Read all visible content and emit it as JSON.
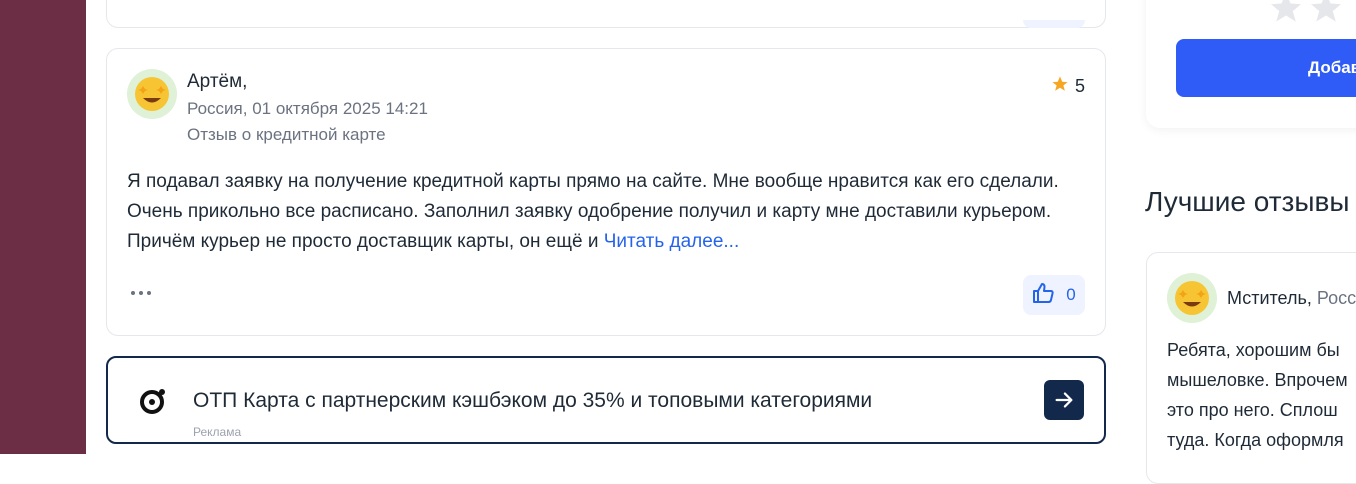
{
  "colors": {
    "side_band": "#6c2e45",
    "accent_blue": "#2563eb",
    "primary_button": "#2f5cf6",
    "ad_border": "#13294b",
    "star": "#f5a623"
  },
  "review": {
    "author": "Артём,",
    "meta": "Россия, 01 октября 2025 14:21",
    "category": "Отзыв о кредитной карте",
    "rating": "5",
    "text": "Я подавал заявку на получение кредитной карты прямо на сайте. Мне вообще нравится как его сделали. Очень прикольно все расписано. Заполнил заявку одобрение получил и карту мне доставили курьером. Причём курьер не просто доставщик карты, он ещё и ",
    "read_more": "Читать далее...",
    "likes": "0",
    "icons": {
      "avatar": "star-struck-emoji-icon",
      "rating": "star-icon",
      "more": "more-dots-icon",
      "like": "thumbs-up-icon"
    }
  },
  "ad": {
    "text": "ОТП Карта с партнерским кэшбэком до 35% и топовыми категориями",
    "label": "Реклама",
    "icons": {
      "logo": "otp-logo-icon",
      "arrow": "arrow-right-icon"
    }
  },
  "sidebar": {
    "add_button": "Добав",
    "best_title": "Лучшие отзывы",
    "best_review": {
      "author": "Мститель,",
      "country": "Росс",
      "lines": [
        "Ребята, хорошим бы",
        "мышеловке. Впрочем",
        "это про него. Сплош",
        "туда. Когда оформля"
      ]
    }
  }
}
